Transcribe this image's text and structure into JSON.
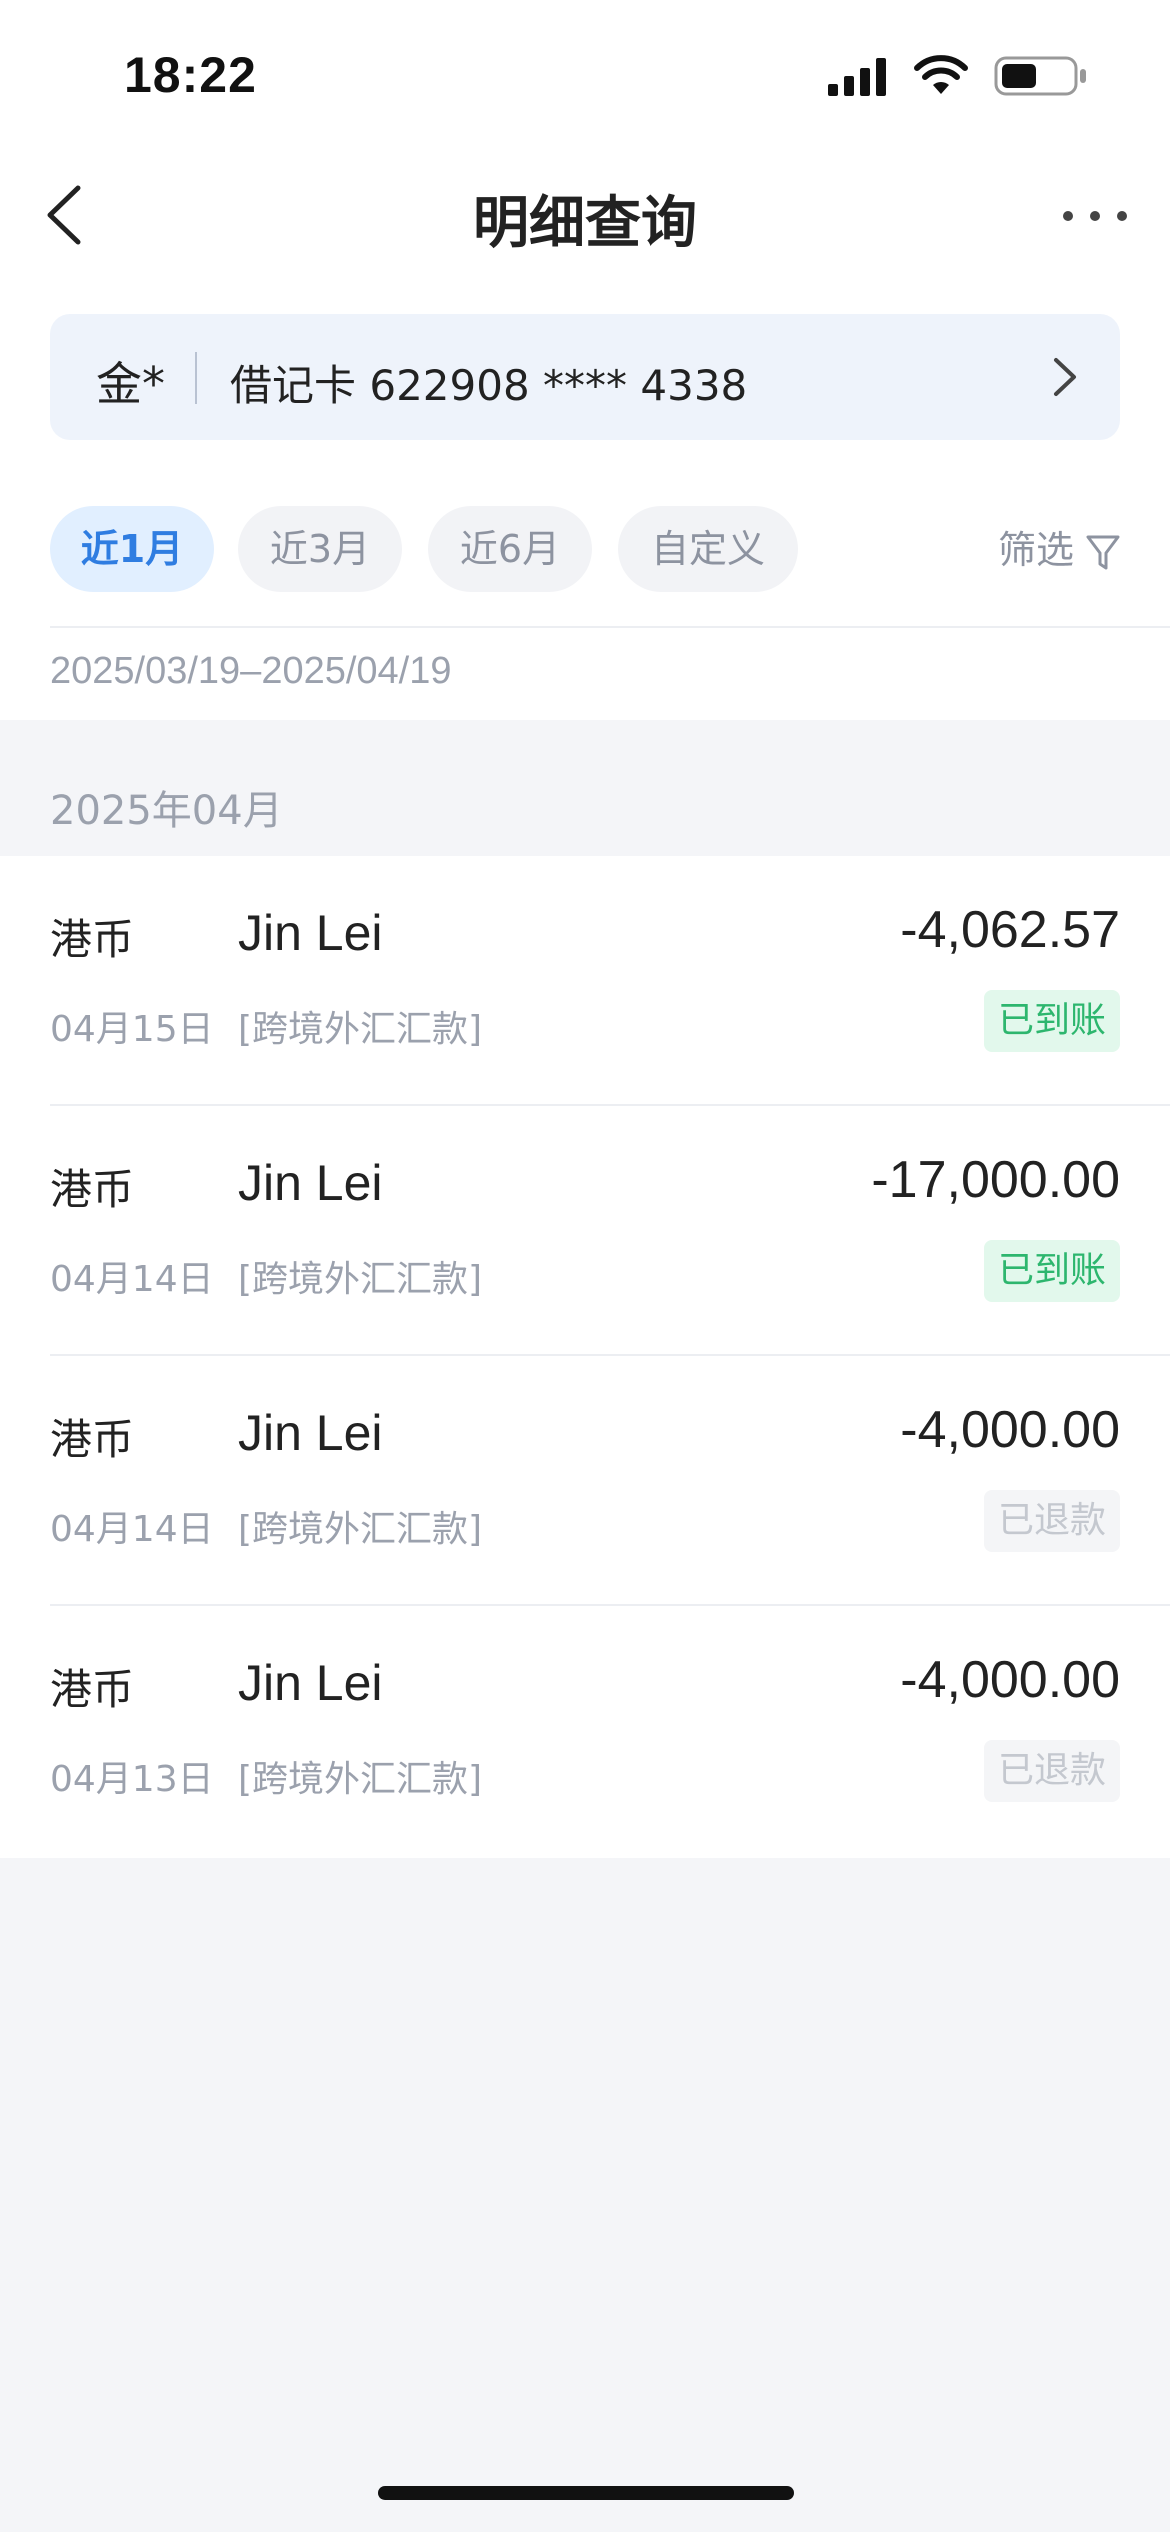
{
  "status_bar": {
    "time": "18:22"
  },
  "nav": {
    "title": "明细查询",
    "back_icon": "chevron-left-icon",
    "more_icon": "more-horizontal-icon"
  },
  "account": {
    "holder": "金*",
    "card": "借记卡 622908 **** 4338"
  },
  "periods": [
    {
      "label": "近1月",
      "active": true
    },
    {
      "label": "近3月",
      "active": false
    },
    {
      "label": "近6月",
      "active": false
    },
    {
      "label": "自定义",
      "active": false
    }
  ],
  "filter": {
    "label": "筛选",
    "icon": "filter-funnel-icon"
  },
  "date_range": "2025/03/19–2025/04/19",
  "month_header": "2025年04月",
  "transactions": [
    {
      "currency": "港币",
      "name": "Jin Lei",
      "amount": "-4,062.57",
      "date": "04月15日",
      "type": "[跨境外汇汇款]",
      "status": "已到账"
    },
    {
      "currency": "港币",
      "name": "Jin Lei",
      "amount": "-17,000.00",
      "date": "04月14日",
      "type": "[跨境外汇汇款]",
      "status": "已到账"
    },
    {
      "currency": "港币",
      "name": "Jin Lei",
      "amount": "-4,000.00",
      "date": "04月14日",
      "type": "[跨境外汇汇款]",
      "status": "已退款"
    },
    {
      "currency": "港币",
      "name": "Jin Lei",
      "amount": "-4,000.00",
      "date": "04月13日",
      "type": "[跨境外汇汇款]",
      "status": "已退款"
    }
  ],
  "colors": {
    "accent": "#2f7de1",
    "chip_active_bg": "#e1efff",
    "status_ok": "#2db66e",
    "status_ok_bg": "#e2f8ec",
    "status_refund": "#c4c8cf",
    "page_bg": "#f4f5f8"
  }
}
